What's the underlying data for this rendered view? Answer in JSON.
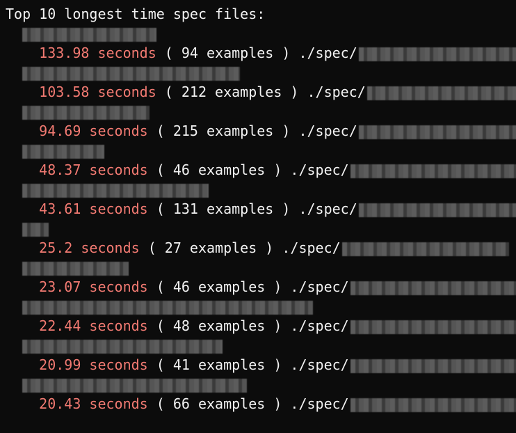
{
  "terminal": {
    "heading": "Top 10 longest time spec files:",
    "colors": {
      "background": "#0c0c0c",
      "text": "#f2f2f2",
      "time": "#f27a72"
    },
    "entries": [
      {
        "time": "133.98 seconds",
        "rest": " ( 94 examples ) ./spec/"
      },
      {
        "time": "103.58 seconds",
        "rest": " ( 212 examples ) ./spec/"
      },
      {
        "time": "94.69 seconds",
        "rest": " ( 215 examples ) ./spec/"
      },
      {
        "time": "48.37 seconds",
        "rest": " ( 46 examples ) ./spec/"
      },
      {
        "time": "43.61 seconds",
        "rest": " ( 131 examples ) ./spec/"
      },
      {
        "time": "25.2 seconds",
        "rest": " ( 27 examples ) ./spec/"
      },
      {
        "time": "23.07 seconds",
        "rest": " ( 46 examples ) ./spec/"
      },
      {
        "time": "22.44 seconds",
        "rest": " ( 48 examples ) ./spec/"
      },
      {
        "time": "20.99 seconds",
        "rest": " ( 41 examples ) ./spec/"
      },
      {
        "time": "20.43 seconds",
        "rest": " ( 66 examples ) ./spec/"
      }
    ]
  }
}
